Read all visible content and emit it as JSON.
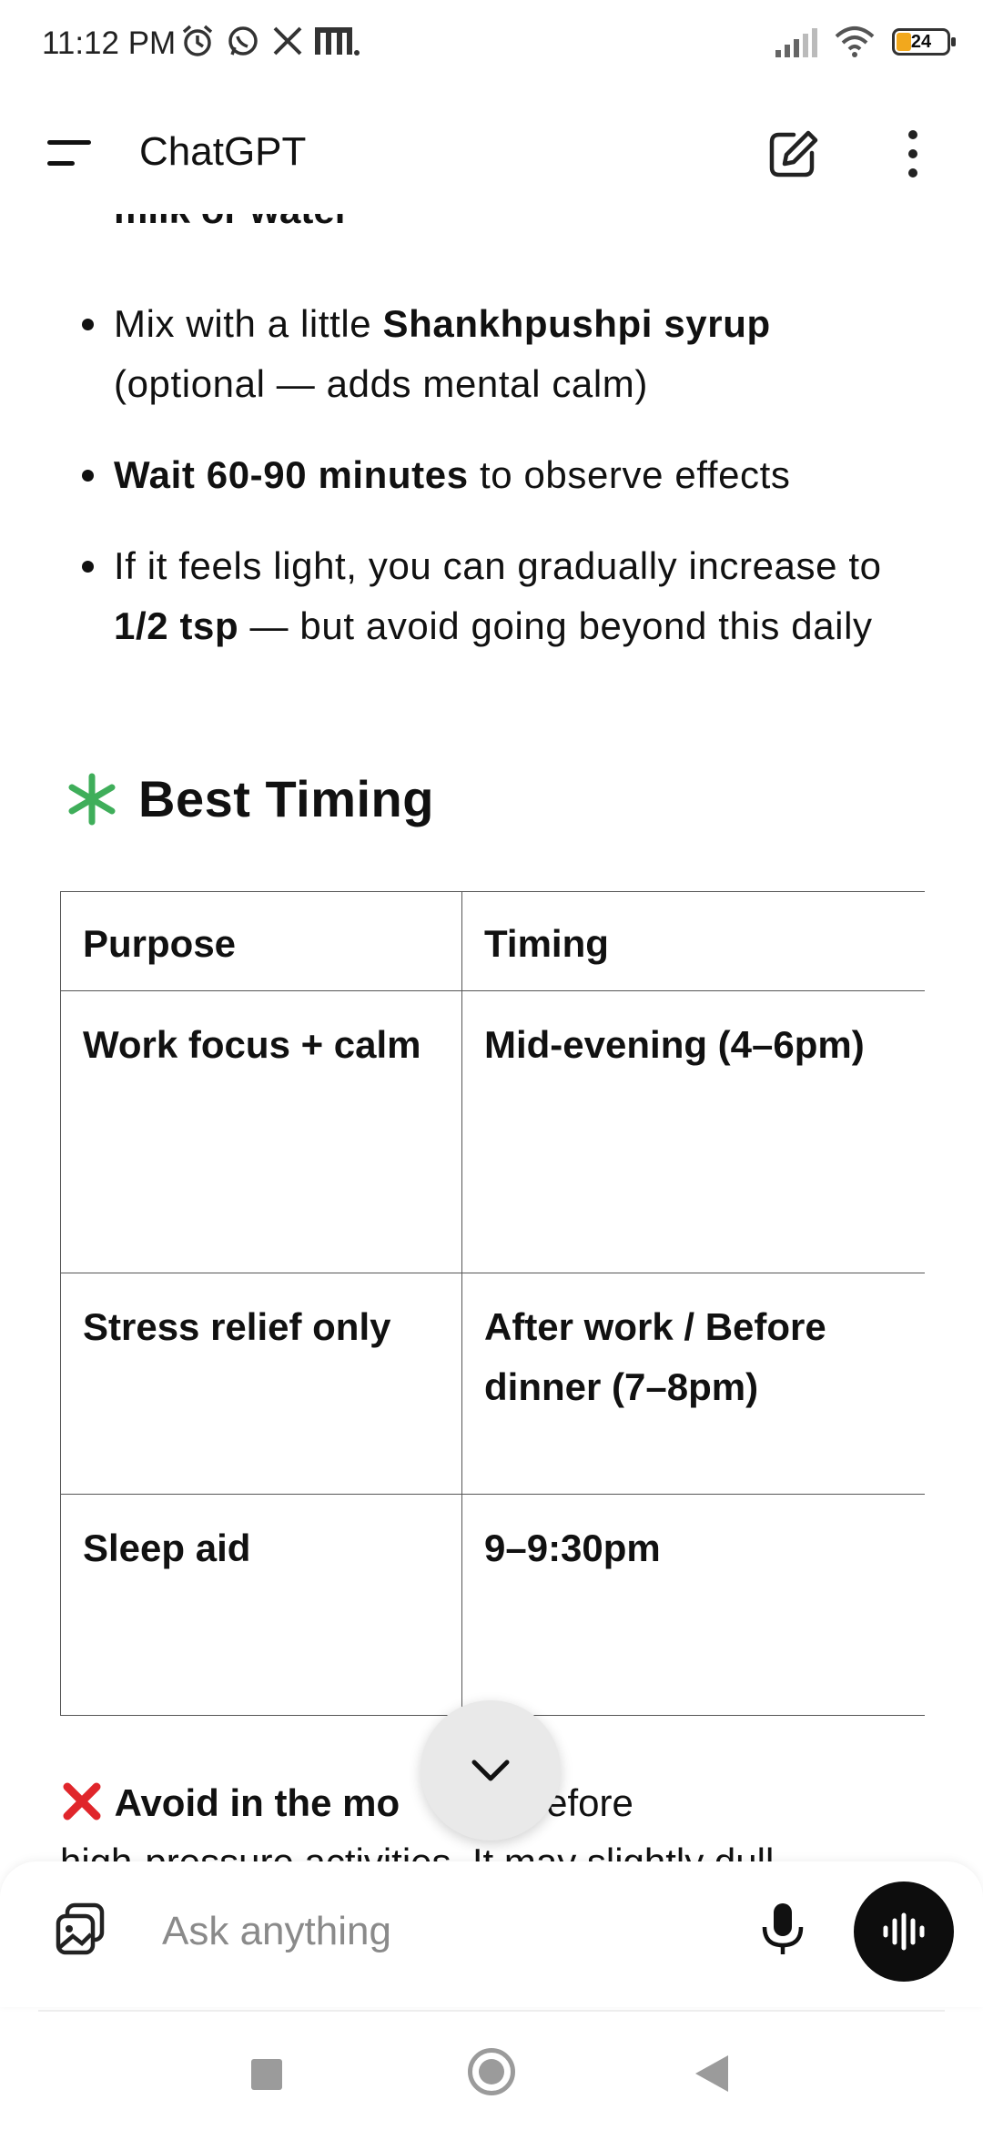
{
  "status_bar": {
    "time": "11:12 PM",
    "battery": "24",
    "icons_left": [
      "alarm-icon",
      "whatsapp-icon",
      "x-icon",
      "m-app-icon"
    ],
    "icons_right": [
      "signal-icon",
      "wifi-icon",
      "battery-icon"
    ]
  },
  "header": {
    "title": "ChatGPT",
    "icons": [
      "menu-icon",
      "new-chat-icon",
      "more-icon"
    ]
  },
  "content": {
    "cut_off_line": "milk or water",
    "bullets": [
      {
        "pre": "Mix with a little ",
        "bold": "Shankhpushpi syrup",
        "post": " (optional — adds mental calm)"
      },
      {
        "pre": "",
        "bold": "Wait 60-90 minutes",
        "post": " to observe effects"
      },
      {
        "pre": "If it feels light, you can gradually increase to ",
        "bold": "1/2 tsp",
        "post": " — but avoid going beyond this daily"
      }
    ],
    "section_emoji": "✳️",
    "section_title": "Best Timing",
    "table": {
      "headers": [
        "Purpose",
        "Timing"
      ],
      "rows": [
        [
          "Work focus + calm",
          "Mid-evening (4–6pm)"
        ],
        [
          "Stress relief only",
          "After work / Before dinner (7–8pm)"
        ],
        [
          "Sleep aid",
          "9–9:30pm"
        ]
      ]
    },
    "warning": {
      "emoji": "❌",
      "bold": "Avoid in the mo",
      "rest": "r before",
      "line2": "high-pressure activities. It may slightly dull"
    }
  },
  "composer": {
    "placeholder": "Ask anything"
  },
  "colors": {
    "accent_green": "#3fae5a",
    "warning_red": "#e0262b",
    "voice_button": "#0d0d0d"
  }
}
